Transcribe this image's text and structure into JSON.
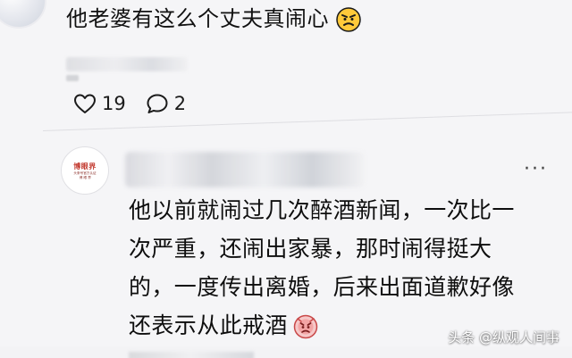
{
  "comment": {
    "text": "他老婆有这么个丈夫真闹心",
    "emoji": "angry-face-icon",
    "likes": "19",
    "replies": "2"
  },
  "reply": {
    "avatar_title": "博眼界",
    "avatar_sub": "头条号官方认证",
    "avatar_sub2": "博 眼 界",
    "lines": [
      "他以前就闹过几次醉酒新闻，一次比一",
      "次严重，还闹出家暴，那时闹得挺大",
      "的，一度传出离婚，后来出面道歉好像",
      "还表示从此戒酒"
    ],
    "more": "···"
  },
  "watermark": "头条 @纵观人间事",
  "colors": {
    "background": "#f5f5f7",
    "text": "#111111",
    "avatar_red": "#c2372c",
    "emoji_face": "#ffc93a"
  }
}
